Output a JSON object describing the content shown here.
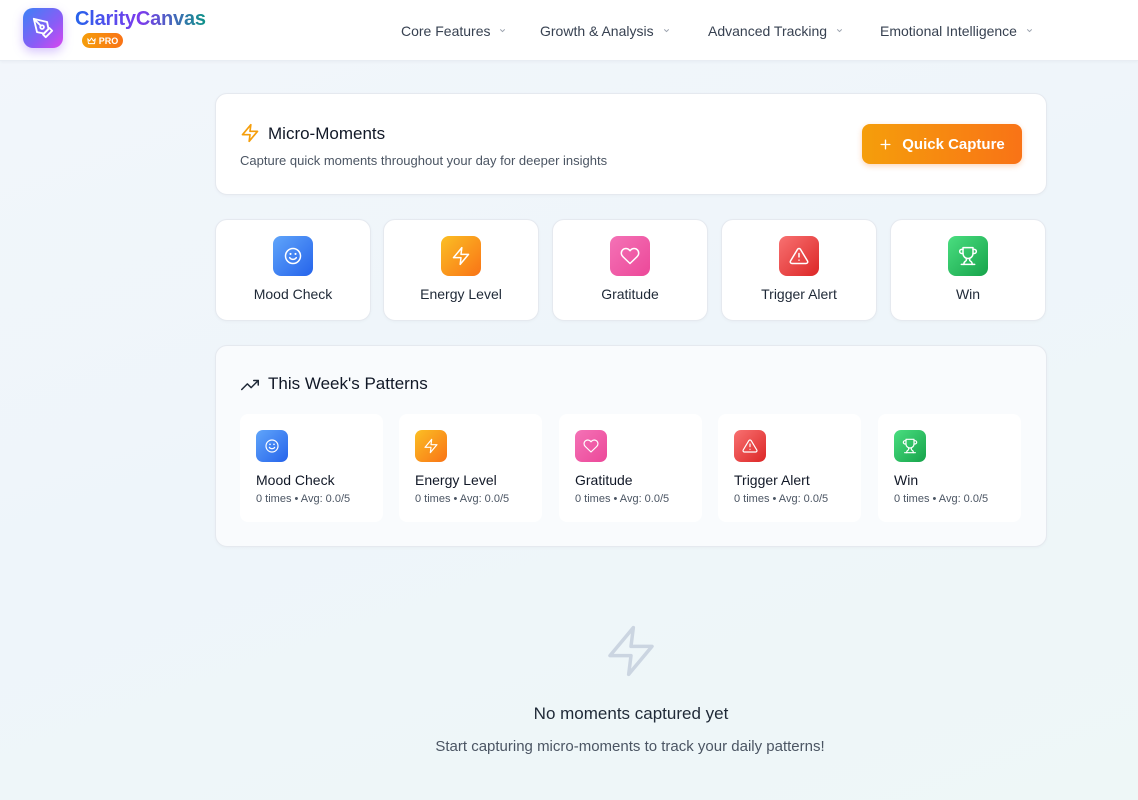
{
  "header": {
    "brand": "ClarityCanvas",
    "badge": "PRO",
    "nav": [
      {
        "label": "Core Features"
      },
      {
        "label": "Growth & Analysis"
      },
      {
        "label": "Advanced Tracking"
      },
      {
        "label": "Emotional Intelligence"
      }
    ]
  },
  "micro_moments": {
    "title": "Micro-Moments",
    "subtitle": "Capture quick moments throughout your day for deeper insights",
    "button_label": "Quick Capture",
    "button_color": "#f97316"
  },
  "moment_types": [
    {
      "label": "Mood Check",
      "icon": "smile-icon",
      "color": "#3b82f6"
    },
    {
      "label": "Energy Level",
      "icon": "lightning-icon",
      "color": "#f59e0b"
    },
    {
      "label": "Gratitude",
      "icon": "heart-icon",
      "color": "#ec4899"
    },
    {
      "label": "Trigger Alert",
      "icon": "warning-icon",
      "color": "#ef4444"
    },
    {
      "label": "Win",
      "icon": "trophy-icon",
      "color": "#22c55e"
    }
  ],
  "patterns": {
    "title": "This Week's Patterns",
    "items": [
      {
        "name": "Mood Check",
        "stats": "0 times • Avg: 0.0/5"
      },
      {
        "name": "Energy Level",
        "stats": "0 times • Avg: 0.0/5"
      },
      {
        "name": "Gratitude",
        "stats": "0 times • Avg: 0.0/5"
      },
      {
        "name": "Trigger Alert",
        "stats": "0 times • Avg: 0.0/5"
      },
      {
        "name": "Win",
        "stats": "0 times • Avg: 0.0/5"
      }
    ]
  },
  "empty_state": {
    "title": "No moments captured yet",
    "subtitle": "Start capturing micro-moments to track your daily patterns!"
  }
}
